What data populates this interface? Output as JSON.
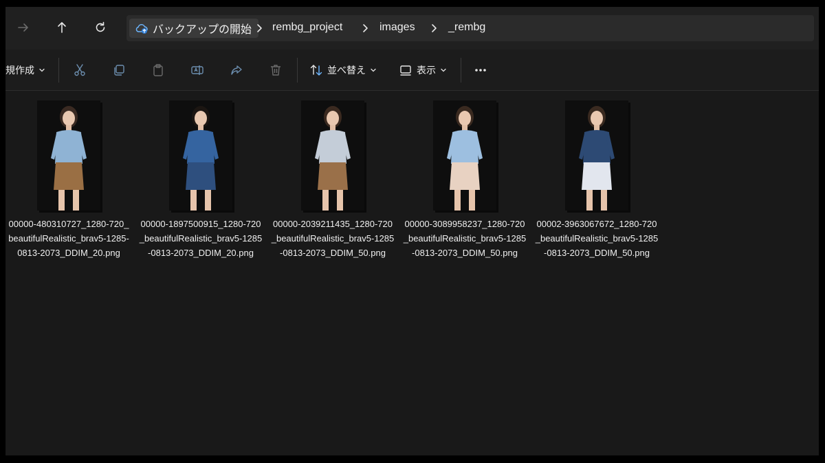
{
  "breadcrumb": {
    "home_label": "バックアップの開始",
    "segments": [
      "rembg_project",
      "images",
      "_rembg"
    ]
  },
  "toolbar": {
    "new_label": "規作成",
    "sort_label": "並べ替え",
    "view_label": "表示"
  },
  "files": [
    {
      "name": "00000-480310727_1280-720_beautifulRealistic_brav5-1285-0813-2073_DDIM_20.png",
      "top_color": "#8fb3d4",
      "bottom_color": "#9a6f44",
      "hair_color": "#3a2a22"
    },
    {
      "name": "00000-1897500915_1280-720_beautifulRealistic_brav5-1285-0813-2073_DDIM_20.png",
      "top_color": "#3564a0",
      "bottom_color": "#2e4f7e",
      "hair_color": "#1c1612"
    },
    {
      "name": "00000-2039211435_1280-720_beautifulRealistic_brav5-1285-0813-2073_DDIM_50.png",
      "top_color": "#c4cdd8",
      "bottom_color": "#9a7049",
      "hair_color": "#3b2a20"
    },
    {
      "name": "00000-3089958237_1280-720_beautifulRealistic_brav5-1285-0813-2073_DDIM_50.png",
      "top_color": "#9dbfe0",
      "bottom_color": "#e8d2c2",
      "hair_color": "#3a2a20"
    },
    {
      "name": "00002-3963067672_1280-720_beautifulRealistic_brav5-1285-0813-2073_DDIM_50.png",
      "top_color": "#2d4a74",
      "bottom_color": "#e2e6ee",
      "hair_color": "#3a2a20"
    }
  ]
}
